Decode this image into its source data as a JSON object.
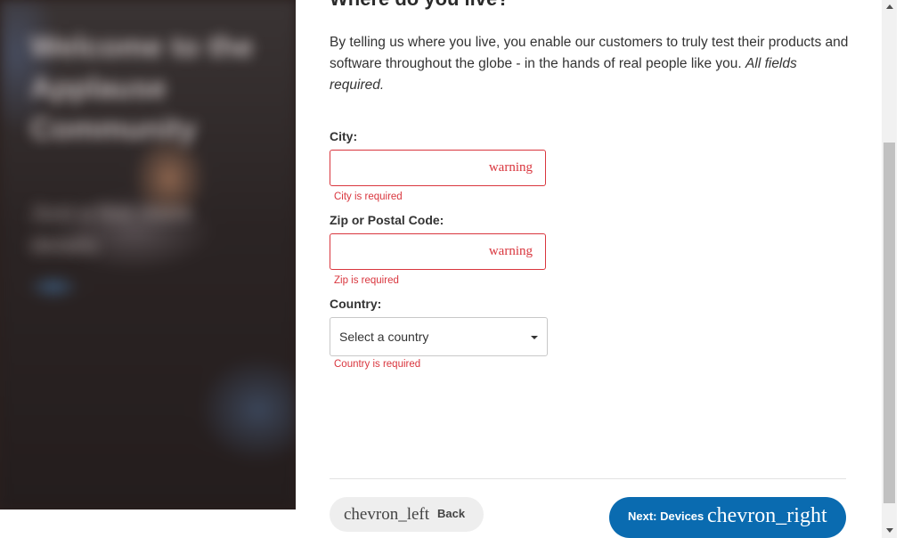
{
  "hero": {
    "title_blurred": "Welcome to the Applause Community",
    "subtitle_blurred": "Just a few more details"
  },
  "heading": "Where do you live?",
  "intro": {
    "text": "By telling us where you live, you enable our customers to truly test their products and software throughout the globe - in the hands of real people like you. ",
    "emphasis": "All fields required."
  },
  "fields": {
    "city": {
      "label": "City:",
      "value": "",
      "status_icon": "warning",
      "error": "City is required"
    },
    "zip": {
      "label": "Zip or Postal Code:",
      "value": "",
      "status_icon": "warning",
      "error": "Zip is required"
    },
    "country": {
      "label": "Country:",
      "selected": "Select a country",
      "error": "Country is required"
    }
  },
  "actions": {
    "back_icon": "chevron_left",
    "back_label": "Back",
    "next_label": "Next: Devices",
    "next_icon": "chevron_right"
  },
  "colors": {
    "error": "#d9363e",
    "primary": "#0a6bb0",
    "back_bg": "#eeeeee"
  }
}
